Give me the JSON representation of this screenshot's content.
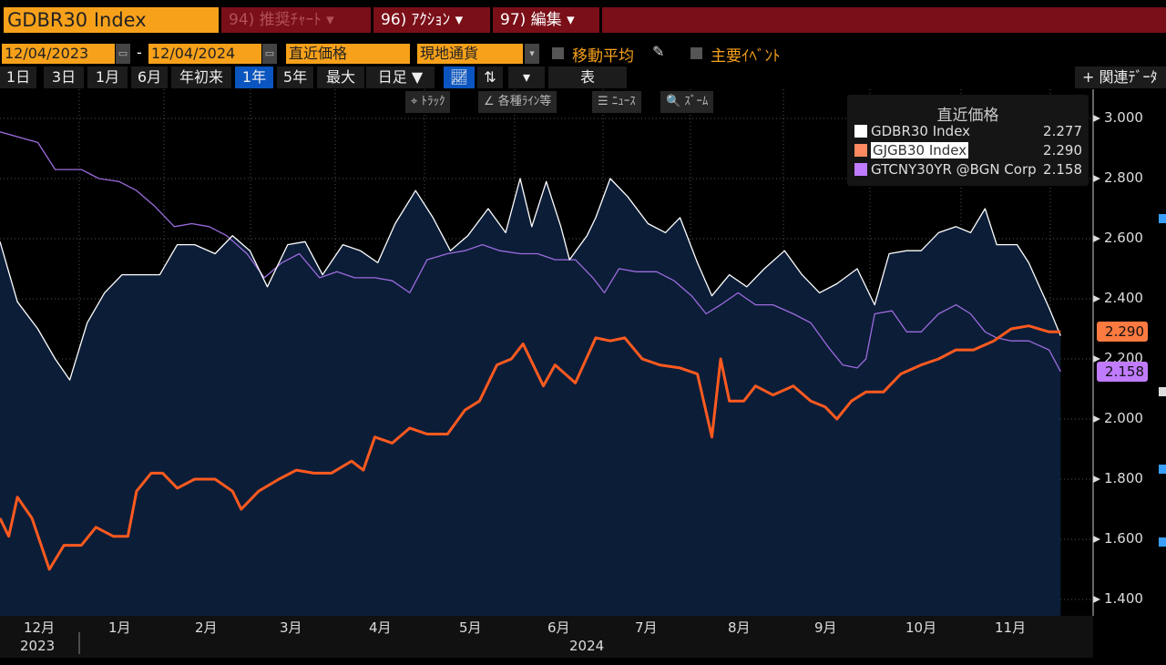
{
  "toolbar": {
    "ticker": "GDBR30 Index",
    "menu1": "94) 推奨ﾁｬｰﾄ ▾",
    "menu2": "96) ｱｸｼｮﾝ ▾",
    "menu3": "97) 編集 ▾"
  },
  "controls": {
    "start_date": "12/04/2023",
    "end_date": "12/04/2024",
    "dash": "-",
    "price_type": "直近価格",
    "currency": "現地通貨",
    "moving_avg": "移動平均",
    "events": "主要ｲﾍﾞﾝﾄ",
    "related": "+ 関連ﾃﾞｰﾀ"
  },
  "periods": [
    "1日",
    "3日",
    "1月",
    "6月",
    "年初来",
    "1年",
    "5年",
    "最大"
  ],
  "active_period": "1年",
  "frequency": "日足 ▼",
  "table_label": "表",
  "tools": {
    "track": "⌖ ﾄﾗｯｸ",
    "lines": "∠ 各種ﾗｲﾝ等",
    "news": "☰ ﾆｭｰｽ",
    "zoom": "🔍 ｽﾞｰﾑ"
  },
  "colors": {
    "white": "#ffffff",
    "orange": "#ff5a1f",
    "purple": "#9b6bdc",
    "fill": "#0c1d38",
    "accent": "#f7a11a",
    "menu": "#7a0f18"
  },
  "chart_data": {
    "type": "line",
    "title": "直近価格",
    "x_unit": "days since 12/04/2023",
    "ylim": [
      1.4,
      3.0
    ],
    "yticks": [
      "3.000",
      "2.800",
      "2.600",
      "2.400",
      "2.200",
      "2.000",
      "1.800",
      "1.600",
      "1.400"
    ],
    "xticks": [
      "12月",
      "1月",
      "2月",
      "3月",
      "4月",
      "5月",
      "6月",
      "7月",
      "8月",
      "9月",
      "10月",
      "11月"
    ],
    "years": [
      "2023",
      "2024"
    ],
    "series": [
      {
        "name": "GDBR30 Index",
        "last": "2.277",
        "color": "#ffffff",
        "points": [
          [
            0,
            2.59
          ],
          [
            6,
            2.39
          ],
          [
            13,
            2.3
          ],
          [
            19,
            2.2
          ],
          [
            24,
            2.13
          ],
          [
            30,
            2.32
          ],
          [
            36,
            2.42
          ],
          [
            42,
            2.48
          ],
          [
            49,
            2.48
          ],
          [
            55,
            2.48
          ],
          [
            61,
            2.58
          ],
          [
            67,
            2.58
          ],
          [
            74,
            2.55
          ],
          [
            80,
            2.61
          ],
          [
            86,
            2.56
          ],
          [
            92,
            2.44
          ],
          [
            99,
            2.58
          ],
          [
            105,
            2.59
          ],
          [
            111,
            2.48
          ],
          [
            118,
            2.58
          ],
          [
            124,
            2.56
          ],
          [
            130,
            2.52
          ],
          [
            136,
            2.65
          ],
          [
            143,
            2.76
          ],
          [
            149,
            2.67
          ],
          [
            155,
            2.56
          ],
          [
            161,
            2.61
          ],
          [
            168,
            2.7
          ],
          [
            174,
            2.62
          ],
          [
            179,
            2.8
          ],
          [
            183,
            2.64
          ],
          [
            188,
            2.79
          ],
          [
            193,
            2.64
          ],
          [
            196,
            2.53
          ],
          [
            202,
            2.61
          ],
          [
            205,
            2.67
          ],
          [
            210,
            2.8
          ],
          [
            216,
            2.74
          ],
          [
            223,
            2.65
          ],
          [
            229,
            2.62
          ],
          [
            234,
            2.67
          ],
          [
            240,
            2.52
          ],
          [
            245,
            2.41
          ],
          [
            251,
            2.48
          ],
          [
            257,
            2.44
          ],
          [
            263,
            2.5
          ],
          [
            270,
            2.56
          ],
          [
            276,
            2.48
          ],
          [
            282,
            2.42
          ],
          [
            288,
            2.45
          ],
          [
            295,
            2.5
          ],
          [
            301,
            2.38
          ],
          [
            306,
            2.55
          ],
          [
            312,
            2.56
          ],
          [
            317,
            2.56
          ],
          [
            323,
            2.62
          ],
          [
            329,
            2.64
          ],
          [
            334,
            2.62
          ],
          [
            339,
            2.7
          ],
          [
            343,
            2.58
          ],
          [
            350,
            2.58
          ],
          [
            354,
            2.52
          ],
          [
            361,
            2.37
          ],
          [
            365,
            2.277
          ]
        ]
      },
      {
        "name": "GJGB30 Index",
        "last": "2.290",
        "color": "#ff5a1f",
        "points": [
          [
            0,
            1.67
          ],
          [
            3,
            1.61
          ],
          [
            6,
            1.74
          ],
          [
            11,
            1.67
          ],
          [
            17,
            1.5
          ],
          [
            22,
            1.58
          ],
          [
            28,
            1.58
          ],
          [
            33,
            1.64
          ],
          [
            39,
            1.61
          ],
          [
            44,
            1.61
          ],
          [
            47,
            1.76
          ],
          [
            52,
            1.82
          ],
          [
            56,
            1.82
          ],
          [
            61,
            1.77
          ],
          [
            67,
            1.8
          ],
          [
            74,
            1.8
          ],
          [
            80,
            1.76
          ],
          [
            83,
            1.7
          ],
          [
            89,
            1.76
          ],
          [
            96,
            1.8
          ],
          [
            102,
            1.83
          ],
          [
            108,
            1.82
          ],
          [
            114,
            1.82
          ],
          [
            121,
            1.86
          ],
          [
            125,
            1.83
          ],
          [
            129,
            1.94
          ],
          [
            135,
            1.92
          ],
          [
            141,
            1.97
          ],
          [
            147,
            1.95
          ],
          [
            154,
            1.95
          ],
          [
            160,
            2.03
          ],
          [
            165,
            2.06
          ],
          [
            171,
            2.18
          ],
          [
            176,
            2.2
          ],
          [
            180,
            2.25
          ],
          [
            187,
            2.11
          ],
          [
            191,
            2.18
          ],
          [
            198,
            2.12
          ],
          [
            205,
            2.27
          ],
          [
            210,
            2.26
          ],
          [
            215,
            2.27
          ],
          [
            221,
            2.2
          ],
          [
            227,
            2.18
          ],
          [
            234,
            2.17
          ],
          [
            240,
            2.15
          ],
          [
            245,
            1.94
          ],
          [
            248,
            2.2
          ],
          [
            251,
            2.06
          ],
          [
            256,
            2.06
          ],
          [
            260,
            2.11
          ],
          [
            266,
            2.08
          ],
          [
            273,
            2.11
          ],
          [
            279,
            2.06
          ],
          [
            284,
            2.04
          ],
          [
            288,
            2.0
          ],
          [
            293,
            2.06
          ],
          [
            298,
            2.09
          ],
          [
            304,
            2.09
          ],
          [
            310,
            2.15
          ],
          [
            317,
            2.18
          ],
          [
            323,
            2.2
          ],
          [
            329,
            2.23
          ],
          [
            335,
            2.23
          ],
          [
            342,
            2.26
          ],
          [
            348,
            2.3
          ],
          [
            354,
            2.31
          ],
          [
            361,
            2.29
          ],
          [
            365,
            2.29
          ]
        ]
      },
      {
        "name": "GTCNY30YR @BGN Corp",
        "last": "2.158",
        "color": "#9b6bdc",
        "points": [
          [
            0,
            2.955
          ],
          [
            13,
            2.92
          ],
          [
            19,
            2.83
          ],
          [
            28,
            2.83
          ],
          [
            34,
            2.8
          ],
          [
            41,
            2.79
          ],
          [
            47,
            2.76
          ],
          [
            53,
            2.71
          ],
          [
            60,
            2.64
          ],
          [
            66,
            2.65
          ],
          [
            72,
            2.64
          ],
          [
            78,
            2.61
          ],
          [
            85,
            2.55
          ],
          [
            91,
            2.47
          ],
          [
            97,
            2.52
          ],
          [
            103,
            2.55
          ],
          [
            110,
            2.47
          ],
          [
            116,
            2.49
          ],
          [
            122,
            2.47
          ],
          [
            129,
            2.47
          ],
          [
            135,
            2.46
          ],
          [
            141,
            2.42
          ],
          [
            147,
            2.53
          ],
          [
            154,
            2.55
          ],
          [
            160,
            2.56
          ],
          [
            166,
            2.58
          ],
          [
            172,
            2.56
          ],
          [
            179,
            2.55
          ],
          [
            185,
            2.55
          ],
          [
            191,
            2.53
          ],
          [
            198,
            2.53
          ],
          [
            204,
            2.47
          ],
          [
            208,
            2.42
          ],
          [
            213,
            2.5
          ],
          [
            219,
            2.49
          ],
          [
            226,
            2.49
          ],
          [
            232,
            2.46
          ],
          [
            238,
            2.41
          ],
          [
            243,
            2.35
          ],
          [
            248,
            2.38
          ],
          [
            254,
            2.42
          ],
          [
            260,
            2.38
          ],
          [
            266,
            2.38
          ],
          [
            273,
            2.35
          ],
          [
            279,
            2.32
          ],
          [
            285,
            2.24
          ],
          [
            290,
            2.18
          ],
          [
            295,
            2.17
          ],
          [
            298,
            2.2
          ],
          [
            301,
            2.35
          ],
          [
            307,
            2.36
          ],
          [
            312,
            2.29
          ],
          [
            317,
            2.29
          ],
          [
            323,
            2.35
          ],
          [
            329,
            2.38
          ],
          [
            334,
            2.35
          ],
          [
            339,
            2.29
          ],
          [
            343,
            2.27
          ],
          [
            348,
            2.26
          ],
          [
            354,
            2.26
          ],
          [
            361,
            2.23
          ],
          [
            365,
            2.158
          ]
        ]
      }
    ]
  }
}
